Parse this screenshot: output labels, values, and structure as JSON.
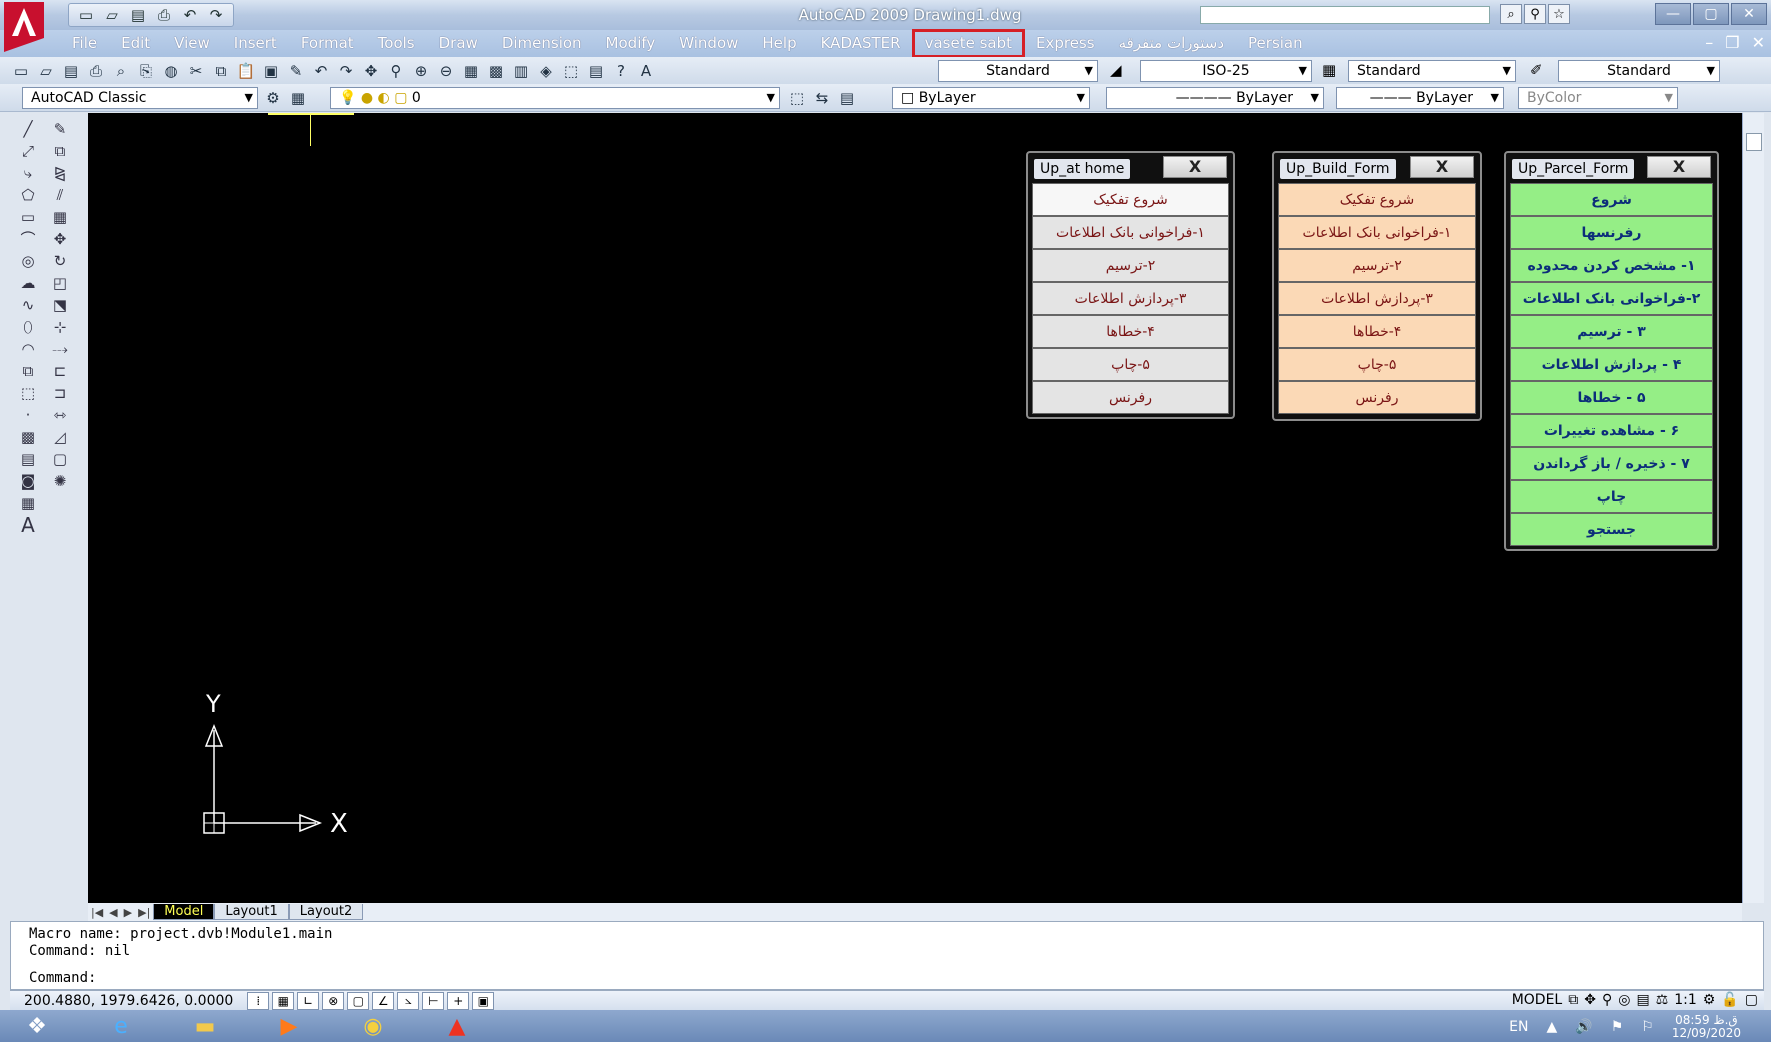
{
  "titlebar": {
    "title": "AutoCAD 2009  Drawing1.dwg",
    "quick_access_icons": [
      "new-icon",
      "open-icon",
      "save-icon",
      "print-icon",
      "undo-icon",
      "redo-icon"
    ],
    "window_controls": [
      "minimize",
      "maximize",
      "close"
    ]
  },
  "menubar": {
    "items": [
      "File",
      "Edit",
      "View",
      "Insert",
      "Format",
      "Tools",
      "Draw",
      "Dimension",
      "Modify",
      "Window",
      "Help",
      "KADASTER",
      "vasete sabt",
      "Express",
      "دستورات متفرقه",
      "Persian"
    ],
    "highlighted": "vasete sabt",
    "highlight_color": "#d61f26"
  },
  "toolbar1": {
    "text_style": "Standard",
    "dim_style": "ISO-25",
    "table_style": "Standard",
    "multileader_style": "Standard"
  },
  "toolbar2": {
    "workspace": "AutoCAD Classic",
    "layer": "0",
    "color": "ByLayer",
    "linetype": "ByLayer",
    "lineweight": "ByLayer",
    "plot_style": "ByColor"
  },
  "ucs": {
    "x_label": "X",
    "y_label": "Y"
  },
  "panels": {
    "home": {
      "title": "Up_at home",
      "close": "X",
      "buttons": [
        "شروع تفکیک",
        "۱-فراخوانی بانک اطلاعات",
        "۲-ترسیم",
        "۳-پردازش اطلاعات",
        "۴-خطاها",
        "۵-چاپ",
        "رفرنس"
      ]
    },
    "build": {
      "title": "Up_Build_Form",
      "close": "X",
      "buttons": [
        "شروع تفکیک",
        "۱-فراخوانی بانک اطلاعات",
        "۲-ترسیم",
        "۳-پردازش اطلاعات",
        "۴-خطاها",
        "۵-چاپ",
        "رفرنس"
      ]
    },
    "parcel": {
      "title": "Up_Parcel_Form",
      "close": "X",
      "buttons": [
        "شروع",
        "رفرنسها",
        "۱- مشخص کردن محدوده",
        "۲-فراخوانی بانک اطلاعات",
        "۳ - ترسیم",
        "۴ - پردازش اطلاعات",
        "۵ - خطاها",
        "۶ - مشاهده تغییرات",
        "۷ - ذخیره / باز گرداندن",
        "چاپ",
        "جستجو"
      ]
    }
  },
  "layout_tabs": {
    "tabs": [
      "Model",
      "Layout1",
      "Layout2"
    ],
    "active": "Model"
  },
  "command_line": {
    "lines": [
      "Macro name: project.dvb!Module1.main",
      "Command: nil"
    ],
    "prompt": "Command:"
  },
  "statusbar": {
    "coordinates": "200.4880, 1979.6426, 0.0000",
    "space": "MODEL",
    "annotation_scale": "1:1"
  },
  "taskbar": {
    "language": "EN",
    "time": "08:59 ق.ظ",
    "date": "12/09/2020"
  }
}
